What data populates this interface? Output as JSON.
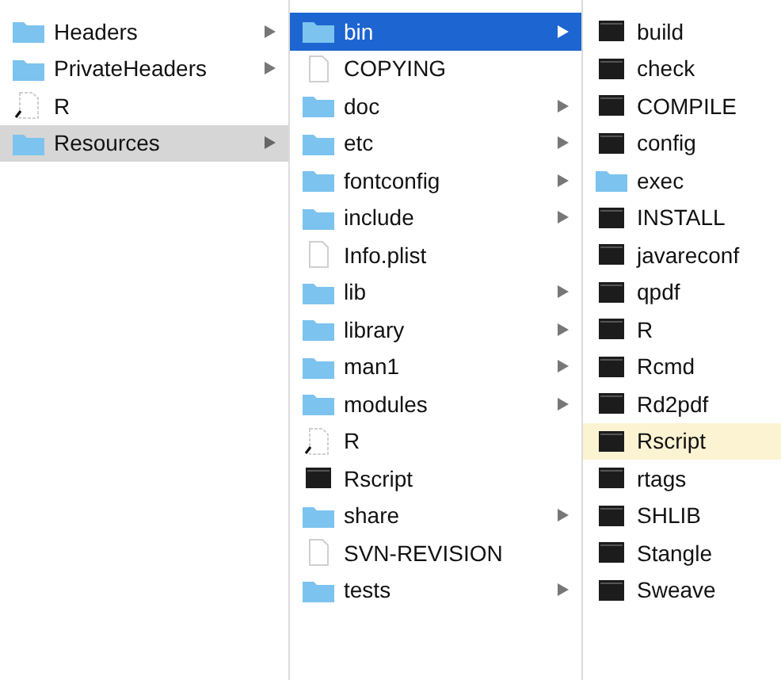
{
  "columns": [
    {
      "active": false,
      "items": [
        {
          "name": "Headers",
          "kind": "folder",
          "has_children": true,
          "selected": false
        },
        {
          "name": "PrivateHeaders",
          "kind": "folder",
          "has_children": true,
          "selected": false
        },
        {
          "name": "R",
          "kind": "alias",
          "has_children": false,
          "selected": false
        },
        {
          "name": "Resources",
          "kind": "folder",
          "has_children": true,
          "selected": true
        }
      ]
    },
    {
      "active": true,
      "items": [
        {
          "name": "bin",
          "kind": "folder",
          "has_children": true,
          "selected": true
        },
        {
          "name": "COPYING",
          "kind": "document",
          "has_children": false,
          "selected": false
        },
        {
          "name": "doc",
          "kind": "folder",
          "has_children": true,
          "selected": false
        },
        {
          "name": "etc",
          "kind": "folder",
          "has_children": true,
          "selected": false
        },
        {
          "name": "fontconfig",
          "kind": "folder",
          "has_children": true,
          "selected": false
        },
        {
          "name": "include",
          "kind": "folder",
          "has_children": true,
          "selected": false
        },
        {
          "name": "Info.plist",
          "kind": "document",
          "has_children": false,
          "selected": false
        },
        {
          "name": "lib",
          "kind": "folder",
          "has_children": true,
          "selected": false
        },
        {
          "name": "library",
          "kind": "folder",
          "has_children": true,
          "selected": false
        },
        {
          "name": "man1",
          "kind": "folder",
          "has_children": true,
          "selected": false
        },
        {
          "name": "modules",
          "kind": "folder",
          "has_children": true,
          "selected": false
        },
        {
          "name": "R",
          "kind": "alias",
          "has_children": false,
          "selected": false
        },
        {
          "name": "Rscript",
          "kind": "executable",
          "has_children": false,
          "selected": false
        },
        {
          "name": "share",
          "kind": "folder",
          "has_children": true,
          "selected": false
        },
        {
          "name": "SVN-REVISION",
          "kind": "document",
          "has_children": false,
          "selected": false
        },
        {
          "name": "tests",
          "kind": "folder",
          "has_children": true,
          "selected": false
        }
      ]
    },
    {
      "items": [
        {
          "name": "build",
          "kind": "executable",
          "highlighted": false
        },
        {
          "name": "check",
          "kind": "executable",
          "highlighted": false
        },
        {
          "name": "COMPILE",
          "kind": "executable",
          "highlighted": false
        },
        {
          "name": "config",
          "kind": "executable",
          "highlighted": false
        },
        {
          "name": "exec",
          "kind": "folder",
          "highlighted": false
        },
        {
          "name": "INSTALL",
          "kind": "executable",
          "highlighted": false
        },
        {
          "name": "javareconf",
          "kind": "executable",
          "highlighted": false
        },
        {
          "name": "qpdf",
          "kind": "executable",
          "highlighted": false
        },
        {
          "name": "R",
          "kind": "executable",
          "highlighted": false
        },
        {
          "name": "Rcmd",
          "kind": "executable",
          "highlighted": false
        },
        {
          "name": "Rd2pdf",
          "kind": "executable",
          "highlighted": false
        },
        {
          "name": "Rscript",
          "kind": "executable",
          "highlighted": true
        },
        {
          "name": "rtags",
          "kind": "executable",
          "highlighted": false
        },
        {
          "name": "SHLIB",
          "kind": "executable",
          "highlighted": false
        },
        {
          "name": "Stangle",
          "kind": "executable",
          "highlighted": false
        },
        {
          "name": "Sweave",
          "kind": "executable",
          "highlighted": false
        }
      ]
    }
  ]
}
